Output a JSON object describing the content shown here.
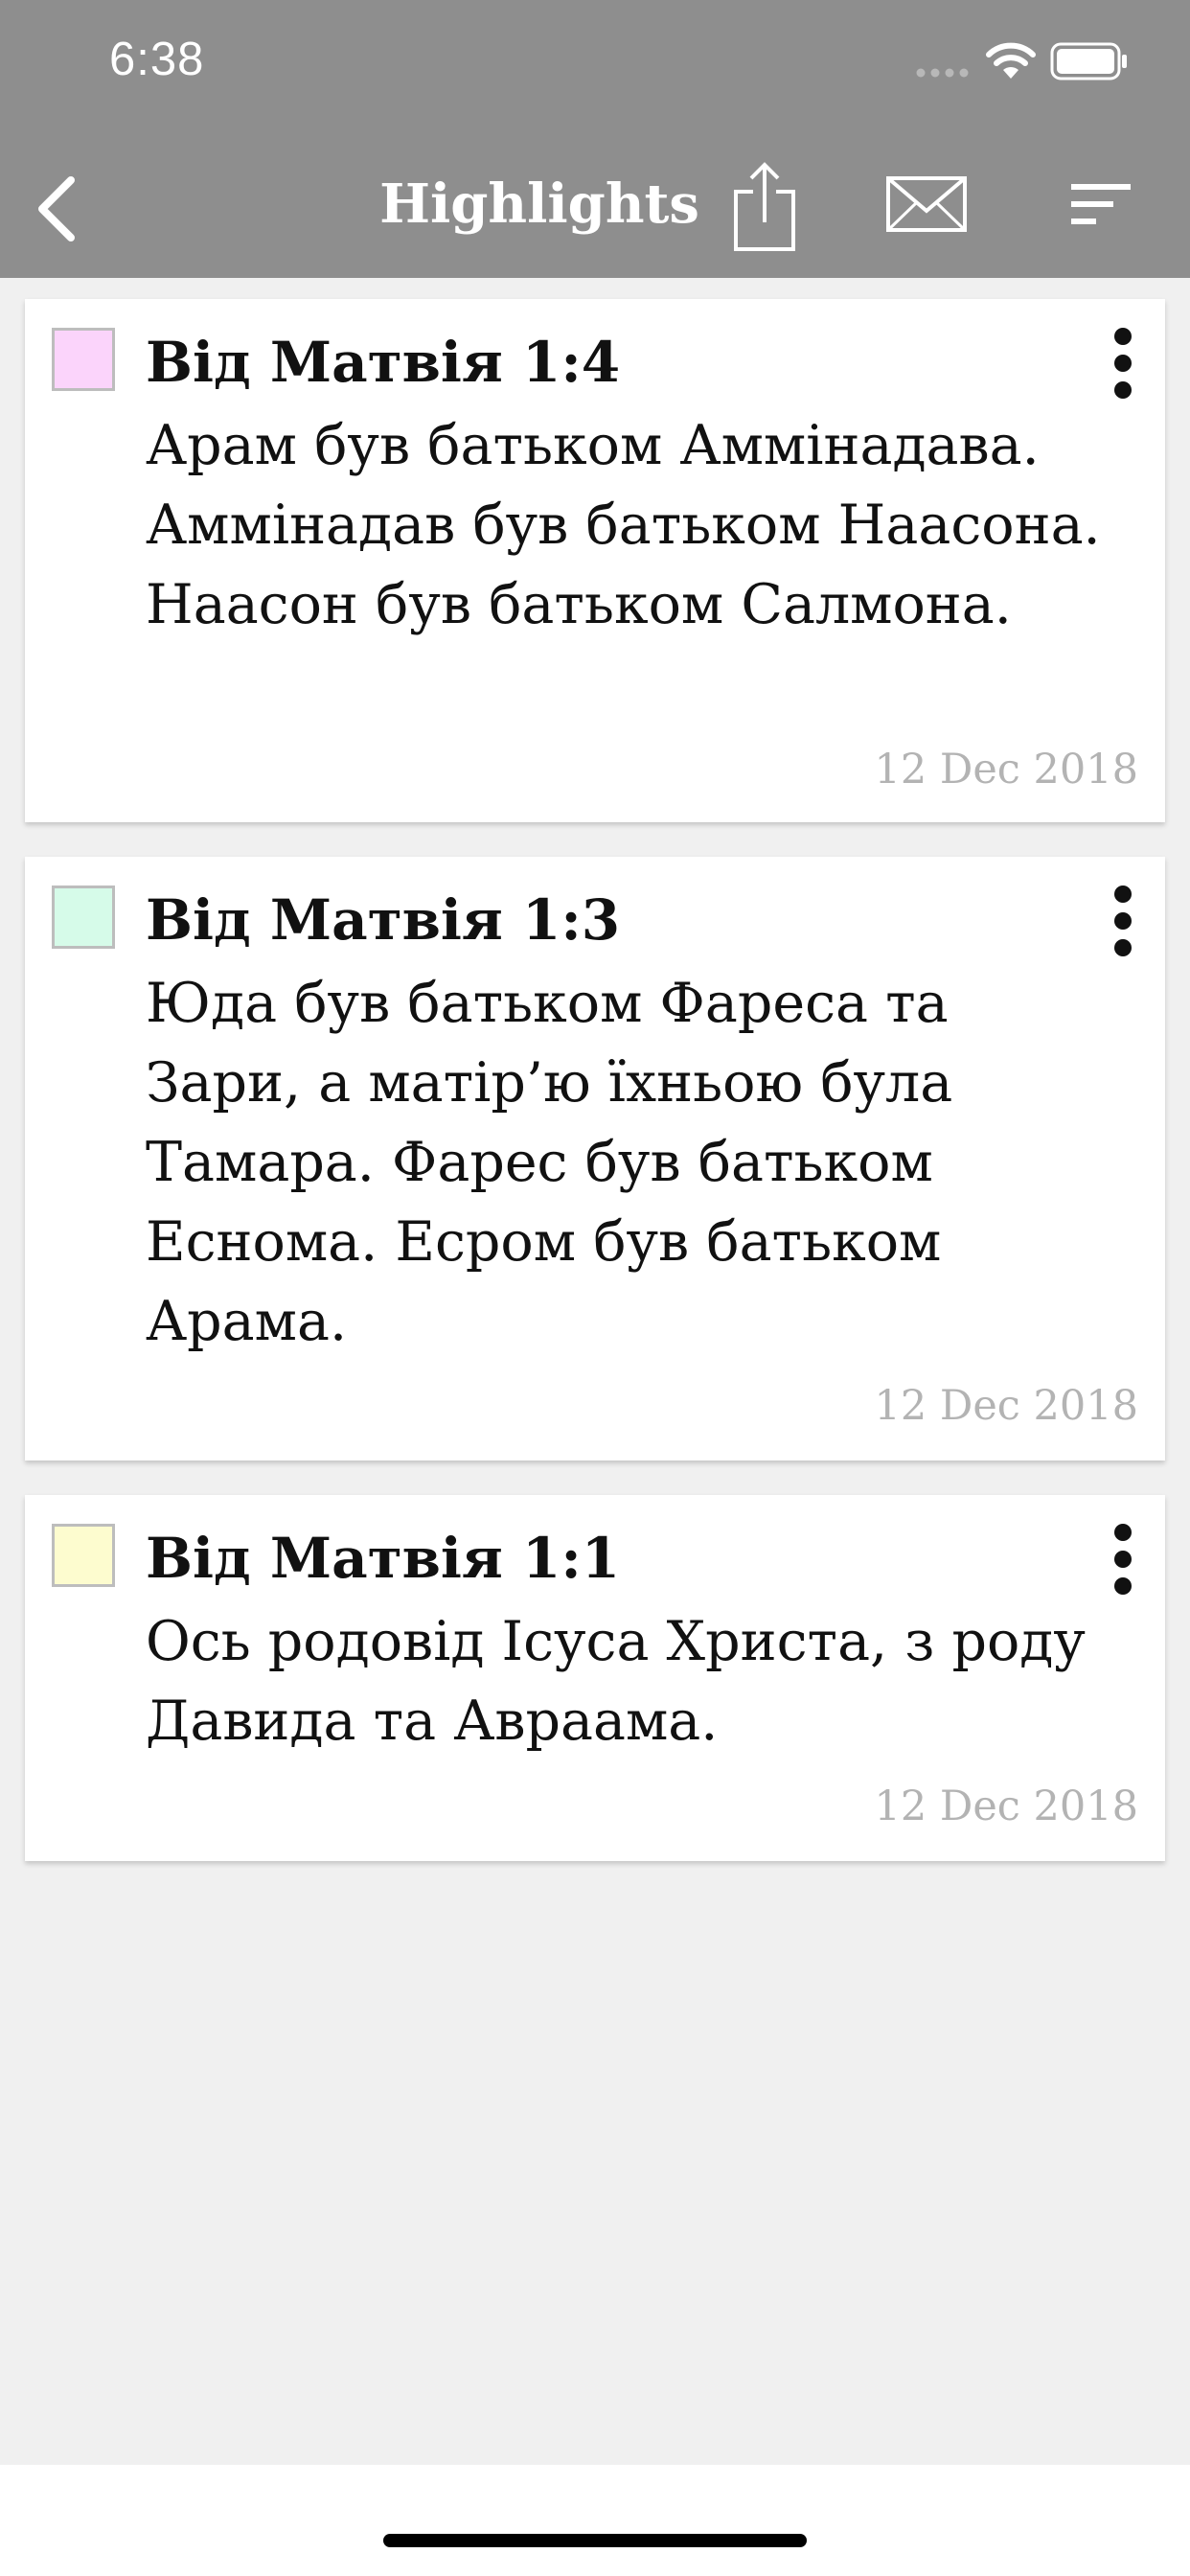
{
  "status_bar": {
    "time": "6:38"
  },
  "nav": {
    "title": "Highlights",
    "icons": {
      "back": "chevron-left-icon",
      "share": "share-icon",
      "mail": "mail-icon",
      "sort": "sort-icon"
    }
  },
  "highlights": [
    {
      "reference": "Від Матвія 1:4",
      "text": "Арам був батьком Аммінадава. Аммінадав був батьком Наасона. Наасон був батьком Салмона.",
      "date": "12 Dec 2018",
      "color": "#fbd4fb"
    },
    {
      "reference": "Від Матвія 1:3",
      "text": "Юда був батьком Фареса та Зари, а матір’ю їхньою була Тамара. Фарес був батьком Еснома. Есрoм був батьком Арама.",
      "date": "12 Dec 2018",
      "color": "#d6fbe9"
    },
    {
      "reference": "Від Матвія 1:1",
      "text": "Ось родовід Ісуса Христа, з роду Давида та Авраама.",
      "date": "12 Dec 2018",
      "color": "#fdfccf"
    }
  ],
  "colors": {
    "header_bg": "#8e8e8e",
    "page_bg": "#f0f0f0",
    "date_text": "#b3b3b3"
  }
}
